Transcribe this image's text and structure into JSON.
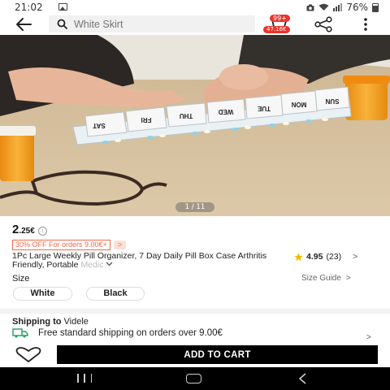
{
  "status_bar": {
    "time": "21:02",
    "battery": "76%"
  },
  "header": {
    "search_placeholder": "White Skirt",
    "cart_badge": "99+",
    "cart_price": "47.16€"
  },
  "gallery": {
    "counter": "1 / 11",
    "pill_days": [
      "SAT",
      "FRI",
      "THU",
      "WED",
      "TUE",
      "MON",
      "SUN"
    ]
  },
  "product": {
    "price_int": "2",
    "price_dec": ".25€",
    "price_info": "i",
    "promo_tag": "30% OFF For orders 9.00€+",
    "promo_arrow": ">",
    "title_main": "1Pc Large Weekly Pill Organizer, 7 Day Daily Pill Box Case Arthritis Friendly,  Portable ",
    "title_fade": "Medic",
    "rating_score": "4.95",
    "rating_count": "(23)",
    "chevron": ">",
    "expand_icon": "chevron-down"
  },
  "size": {
    "label": "Size",
    "guide": "Size Guide",
    "options": [
      "White",
      "Black"
    ]
  },
  "shipping": {
    "title_bold": "Shipping to",
    "title_place": "Videle",
    "line": "Free standard shipping on orders over 9.00€",
    "chevron": ">"
  },
  "actions": {
    "add_to_cart": "ADD TO CART"
  },
  "colors": {
    "accent": "#e8352d",
    "promo": "#f06a4a",
    "star": "#f5b800",
    "button": "#000000"
  }
}
